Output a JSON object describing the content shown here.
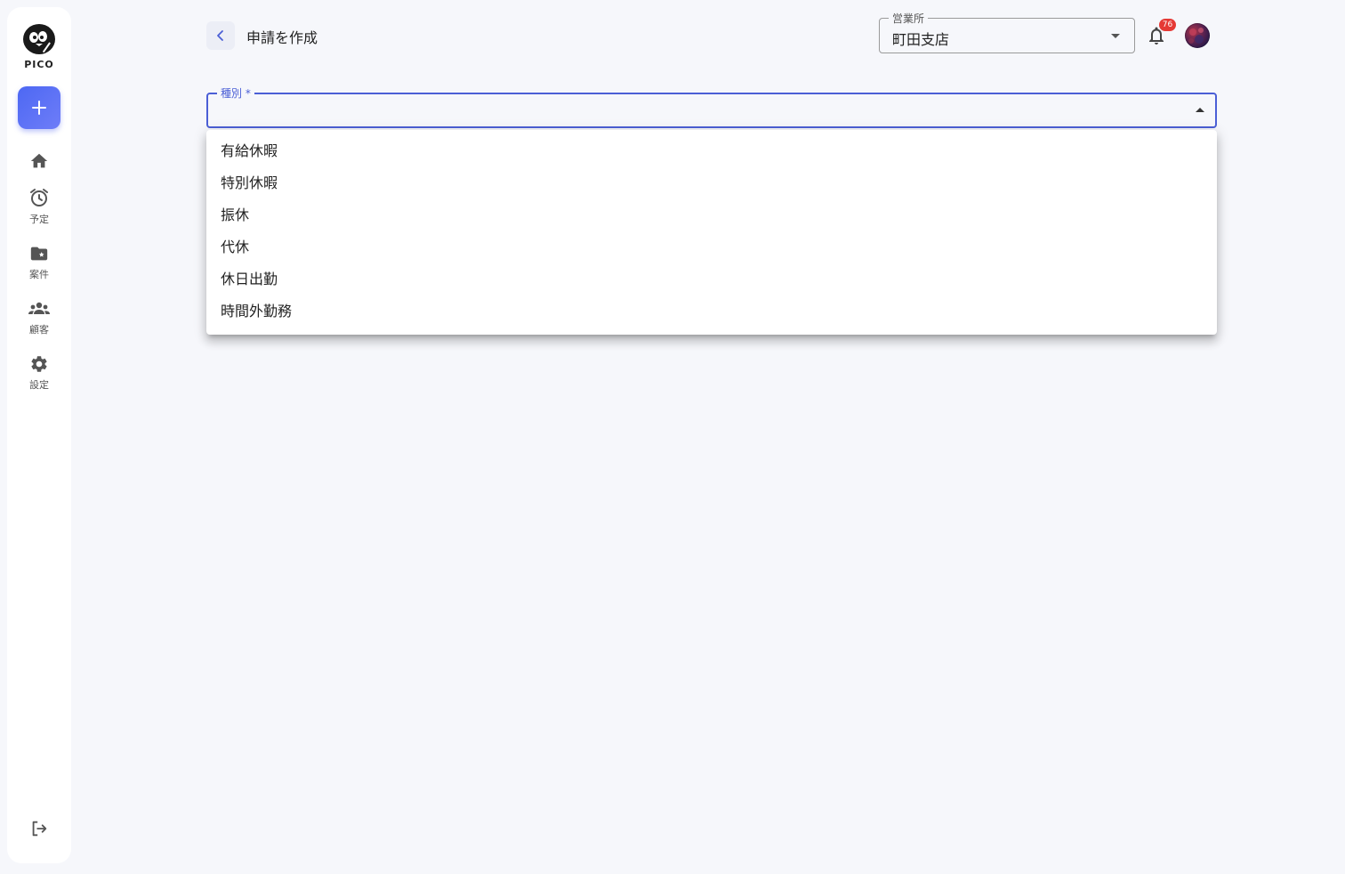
{
  "sidebar": {
    "logo_text": "PICO",
    "items": [
      {
        "label": ""
      },
      {
        "label": "予定"
      },
      {
        "label": "案件"
      },
      {
        "label": "顧客"
      },
      {
        "label": "設定"
      }
    ]
  },
  "header": {
    "title": "申請を作成",
    "office": {
      "legend": "営業所",
      "value": "町田支店"
    },
    "notification_count": "76"
  },
  "form": {
    "type_label": "種別 *",
    "type_value": "",
    "options": [
      "有給休暇",
      "特別休暇",
      "振休",
      "代休",
      "休日出勤",
      "時間外勤務"
    ]
  },
  "colors": {
    "accent": "#4b5fd6",
    "badge": "#e53935",
    "background": "#f6f7fb"
  },
  "icons": {
    "add": "plus-icon",
    "home": "home-icon",
    "schedule": "alarm-icon",
    "projects": "folder-star-icon",
    "customers": "group-icon",
    "settings": "gear-icon",
    "logout": "logout-icon",
    "back": "chevron-left-icon",
    "notifications": "bell-icon"
  }
}
